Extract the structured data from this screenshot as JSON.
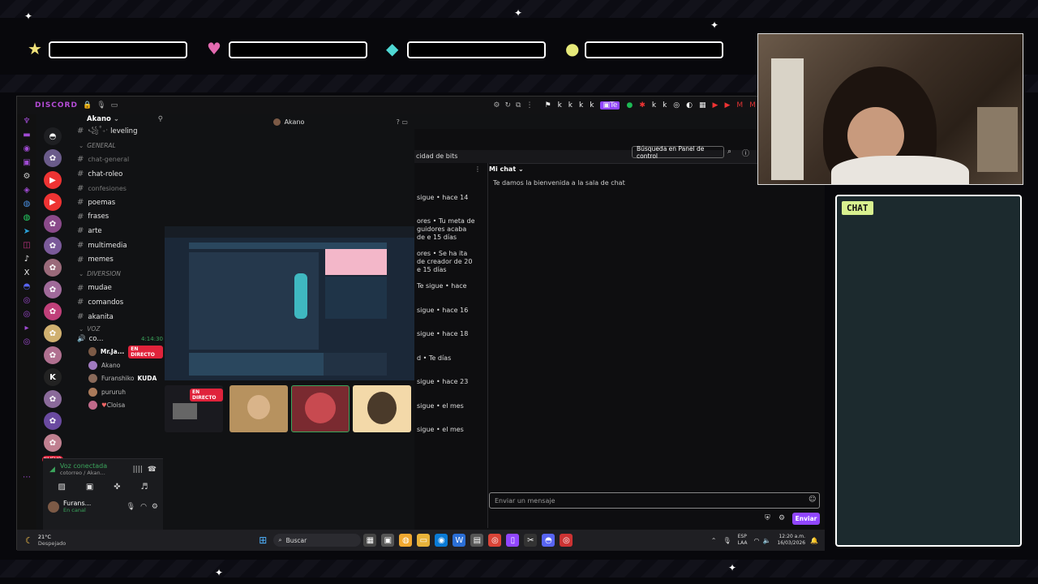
{
  "overlay": {
    "chat_label": "CHAT",
    "bar_icons": [
      "star-icon",
      "heart-icon",
      "gem-icon",
      "coin-icon"
    ]
  },
  "discord": {
    "titlebar_text": "DISCORD",
    "server_name": "Akano",
    "header_title": "Akano",
    "channels": [
      {
        "type": "ch",
        "label": "leveling",
        "prefix": "꧁˚₊‧"
      },
      {
        "type": "cat",
        "label": "GENERAL"
      },
      {
        "type": "ch",
        "label": "chat-general",
        "dim": true
      },
      {
        "type": "ch",
        "label": "chat-roleo"
      },
      {
        "type": "ch",
        "label": "confesiones",
        "dim": true
      },
      {
        "type": "ch",
        "label": "poemas"
      },
      {
        "type": "ch",
        "label": "frases"
      },
      {
        "type": "ch",
        "label": "arte"
      },
      {
        "type": "ch",
        "label": "multimedia"
      },
      {
        "type": "ch",
        "label": "memes"
      },
      {
        "type": "cat",
        "label": "DIVERSION"
      },
      {
        "type": "ch",
        "label": "mudae"
      },
      {
        "type": "ch",
        "label": "comandos"
      },
      {
        "type": "ch",
        "label": "akanita"
      },
      {
        "type": "cat",
        "label": "VOZ"
      }
    ],
    "voice_channel": {
      "name": "co...",
      "timer": "4:14:30"
    },
    "voice_users": [
      {
        "name": "Mr.Ja...",
        "badge": "EN DIRECTO"
      },
      {
        "name": "Akano",
        "badge": ""
      },
      {
        "name": "Furanshiko",
        "badge": "KUDA"
      },
      {
        "name": "pururuh",
        "badge": ""
      },
      {
        "name": "Cloisa",
        "badge": ""
      }
    ],
    "voice_panel": {
      "status": "Voz conectada",
      "sub": "cotorreo / Akan...",
      "user": "Furans...",
      "user_status": "En canal"
    },
    "stream_live_badge": "EN DIRECTO",
    "new_badge": "NUEVO"
  },
  "twitch": {
    "tab_fragment": "cidad de bits",
    "search_button": "Búsqueda en Panel de control",
    "chat_header": "Mi chat",
    "welcome": "Te damos la bienvenida a la sala de chat",
    "input_placeholder": "Enviar un mensaje",
    "send_label": "Enviar",
    "notifications": [
      "sigue • hace 14",
      "ores • Tu meta de guidores acaba de e 15 días",
      "ores • Se ha ita de creador de 20 e 15 días",
      "Te sigue • hace",
      "sigue • hace 16",
      "sigue • hace 18",
      "d • Te días",
      "sigue • hace 23",
      "sigue • el mes",
      "sigue • el mes"
    ]
  },
  "taskbar": {
    "weather_temp": "21°C",
    "weather_text": "Despejado",
    "search": "Buscar",
    "lang": "ESP",
    "lang2": "LAA",
    "time": "12:20 a.m.",
    "date": "16/03/2026"
  }
}
